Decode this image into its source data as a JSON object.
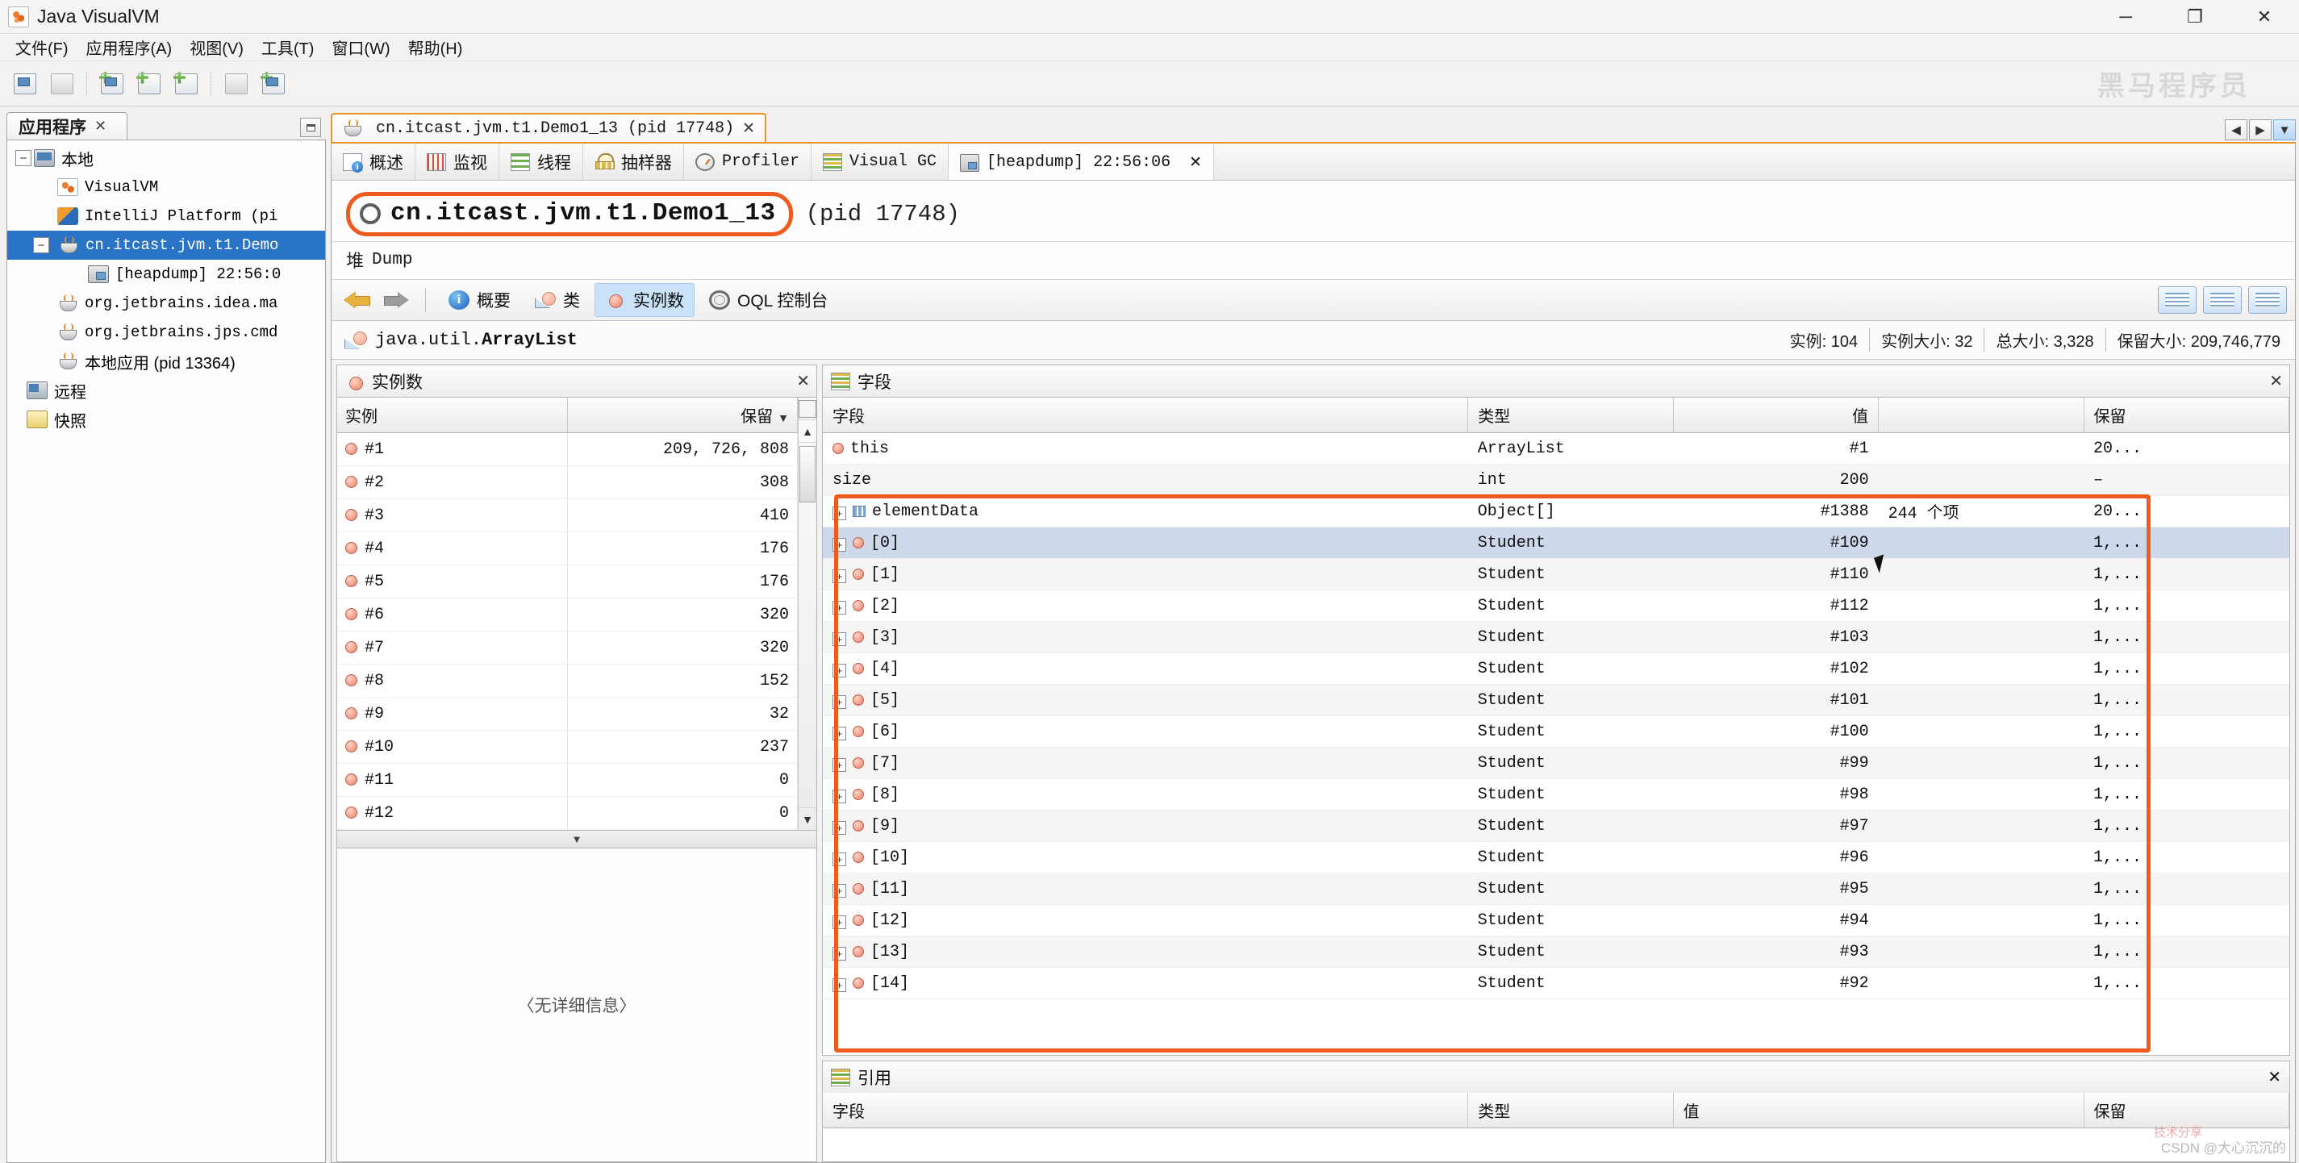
{
  "window": {
    "title": "Java VisualVM",
    "app_icon": "visualvm-icon",
    "controls": {
      "minimize": "─",
      "maximize": "❐",
      "close": "✕"
    }
  },
  "menubar": {
    "items": [
      {
        "label": "文件(F)",
        "name": "menu-file"
      },
      {
        "label": "应用程序(A)",
        "name": "menu-applications"
      },
      {
        "label": "视图(V)",
        "name": "menu-view"
      },
      {
        "label": "工具(T)",
        "name": "menu-tools"
      },
      {
        "label": "窗口(W)",
        "name": "menu-window"
      },
      {
        "label": "帮助(H)",
        "name": "menu-help"
      }
    ]
  },
  "toolbar": {
    "watermark": "黑马程序员",
    "buttons": [
      "load-snapshot-icon",
      "save-snapshot-icon",
      "add-remote-host-icon",
      "add-jmx-connection-icon",
      "add-application-icon",
      "profiler-snapshot-icon",
      "new-window-icon"
    ]
  },
  "sidebar": {
    "tab_label": "应用程序",
    "tab_close": "✕",
    "items": [
      {
        "label": "本地",
        "icon": "monitor-icon",
        "depth": 0,
        "expander": "−",
        "selected": false
      },
      {
        "label": "VisualVM",
        "icon": "visualvm-icon",
        "depth": 1,
        "expander": "",
        "selected": false
      },
      {
        "label": "IntelliJ Platform (pi",
        "icon": "intellij-icon",
        "depth": 1,
        "expander": "",
        "selected": false
      },
      {
        "label": "cn.itcast.jvm.t1.Demo",
        "icon": "java-coffee-icon",
        "depth": 1,
        "expander": "−",
        "selected": true
      },
      {
        "label": "[heapdump] 22:56:0",
        "icon": "heapdump-icon",
        "depth": 2,
        "expander": "",
        "selected": false
      },
      {
        "label": "org.jetbrains.idea.ma",
        "icon": "java-coffee-icon",
        "depth": 1,
        "expander": "",
        "selected": false
      },
      {
        "label": "org.jetbrains.jps.cmd",
        "icon": "java-coffee-icon",
        "depth": 1,
        "expander": "",
        "selected": false
      },
      {
        "label": "本地应用 (pid 13364)",
        "icon": "java-coffee-icon",
        "depth": 1,
        "expander": "",
        "selected": false
      },
      {
        "label": "远程",
        "icon": "remote-icon",
        "depth": 0,
        "expander": "",
        "selected": false
      },
      {
        "label": "快照",
        "icon": "snapshot-icon",
        "depth": 0,
        "expander": "",
        "selected": false
      }
    ]
  },
  "document_tab": {
    "label": "cn.itcast.jvm.t1.Demo1_13 (pid 17748)",
    "icon": "java-coffee-icon",
    "close": "✕",
    "nav_prev": "◀",
    "nav_next": "▶",
    "nav_list": "▼"
  },
  "subtabs": [
    {
      "label": "概述",
      "icon": "overview-icon",
      "active": false
    },
    {
      "label": "监视",
      "icon": "monitor-chart-icon",
      "active": false
    },
    {
      "label": "线程",
      "icon": "threads-icon",
      "active": false
    },
    {
      "label": "抽样器",
      "icon": "sampler-icon",
      "active": false
    },
    {
      "label": "Profiler",
      "icon": "profiler-icon",
      "active": false
    },
    {
      "label": "Visual GC",
      "icon": "visual-gc-icon",
      "active": false
    },
    {
      "label": "[heapdump] 22:56:06",
      "icon": "heapdump-icon",
      "active": true,
      "close": "✕"
    }
  ],
  "heap": {
    "title": "cn.itcast.jvm.t1.Demo1_13",
    "pid": "(pid 17748)",
    "section_glyph": "堆",
    "section_label": "Dump"
  },
  "navbar": {
    "back": "back-arrow-icon",
    "forward": "forward-arrow-icon",
    "items": [
      {
        "label": "概要",
        "icon": "info-icon",
        "active": false
      },
      {
        "label": "类",
        "icon": "classes-icon",
        "active": false
      },
      {
        "label": "实例数",
        "icon": "instances-icon",
        "active": true
      },
      {
        "label": "OQL 控制台",
        "icon": "oql-icon",
        "active": false
      }
    ],
    "right_buttons": [
      "view-mode-1-icon",
      "view-mode-2-icon",
      "view-mode-3-icon"
    ]
  },
  "classbar": {
    "icon": "classes-icon",
    "class_name_prefix": "java.util.",
    "class_name": "ArrayList",
    "stats": [
      "实例: 104",
      "实例大小: 32",
      "总大小: 3,328",
      "保留大小: 209,746,779"
    ]
  },
  "instances_panel": {
    "title": "实例数",
    "icon": "instances-icon",
    "close": "✕",
    "columns": [
      "实例",
      "保留"
    ],
    "sort_column": "保留",
    "sort_arrow": "▼",
    "rows": [
      {
        "instance": "#1",
        "retained": "209, 726, 808"
      },
      {
        "instance": "#2",
        "retained": "308"
      },
      {
        "instance": "#3",
        "retained": "410"
      },
      {
        "instance": "#4",
        "retained": "176"
      },
      {
        "instance": "#5",
        "retained": "176"
      },
      {
        "instance": "#6",
        "retained": "320"
      },
      {
        "instance": "#7",
        "retained": "320"
      },
      {
        "instance": "#8",
        "retained": "152"
      },
      {
        "instance": "#9",
        "retained": "32"
      },
      {
        "instance": "#10",
        "retained": "237"
      },
      {
        "instance": "#11",
        "retained": "0"
      },
      {
        "instance": "#12",
        "retained": "0"
      }
    ],
    "empty_detail": "〈无详细信息〉",
    "scroll_up": "▲",
    "scroll_down": "▼",
    "collapse": "▼"
  },
  "fields_panel": {
    "title": "字段",
    "icon": "fields-icon",
    "close": "✕",
    "columns": [
      "字段",
      "类型",
      "值",
      "保留"
    ],
    "rows": [
      {
        "field": "this",
        "kind": "root",
        "type": "ArrayList",
        "value": "#1",
        "value2": "",
        "retained": "20...",
        "selected": false
      },
      {
        "field": "size",
        "kind": "leaf",
        "type": "int",
        "value": "200",
        "value2": "",
        "retained": "–",
        "selected": false
      },
      {
        "field": "elementData",
        "kind": "array",
        "type": "Object[]",
        "value": "#1388",
        "value2": "244 个项",
        "retained": "20...",
        "selected": false
      },
      {
        "field": "[0]",
        "kind": "child",
        "type": "Student",
        "value": "#109",
        "value2": "",
        "retained": "1,...",
        "selected": true
      },
      {
        "field": "[1]",
        "kind": "child",
        "type": "Student",
        "value": "#110",
        "value2": "",
        "retained": "1,...",
        "selected": false
      },
      {
        "field": "[2]",
        "kind": "child",
        "type": "Student",
        "value": "#112",
        "value2": "",
        "retained": "1,...",
        "selected": false
      },
      {
        "field": "[3]",
        "kind": "child",
        "type": "Student",
        "value": "#103",
        "value2": "",
        "retained": "1,...",
        "selected": false
      },
      {
        "field": "[4]",
        "kind": "child",
        "type": "Student",
        "value": "#102",
        "value2": "",
        "retained": "1,...",
        "selected": false
      },
      {
        "field": "[5]",
        "kind": "child",
        "type": "Student",
        "value": "#101",
        "value2": "",
        "retained": "1,...",
        "selected": false
      },
      {
        "field": "[6]",
        "kind": "child",
        "type": "Student",
        "value": "#100",
        "value2": "",
        "retained": "1,...",
        "selected": false
      },
      {
        "field": "[7]",
        "kind": "child",
        "type": "Student",
        "value": "#99",
        "value2": "",
        "retained": "1,...",
        "selected": false
      },
      {
        "field": "[8]",
        "kind": "child",
        "type": "Student",
        "value": "#98",
        "value2": "",
        "retained": "1,...",
        "selected": false
      },
      {
        "field": "[9]",
        "kind": "child",
        "type": "Student",
        "value": "#97",
        "value2": "",
        "retained": "1,...",
        "selected": false
      },
      {
        "field": "[10]",
        "kind": "child",
        "type": "Student",
        "value": "#96",
        "value2": "",
        "retained": "1,...",
        "selected": false
      },
      {
        "field": "[11]",
        "kind": "child",
        "type": "Student",
        "value": "#95",
        "value2": "",
        "retained": "1,...",
        "selected": false
      },
      {
        "field": "[12]",
        "kind": "child",
        "type": "Student",
        "value": "#94",
        "value2": "",
        "retained": "1,...",
        "selected": false
      },
      {
        "field": "[13]",
        "kind": "child",
        "type": "Student",
        "value": "#93",
        "value2": "",
        "retained": "1,...",
        "selected": false
      },
      {
        "field": "[14]",
        "kind": "child",
        "type": "Student",
        "value": "#92",
        "value2": "",
        "retained": "1,...",
        "selected": false
      }
    ],
    "expander": "+"
  },
  "references_panel": {
    "title": "引用",
    "icon": "references-icon",
    "close": "✕",
    "columns": [
      "字段",
      "类型",
      "值",
      "保留"
    ]
  },
  "watermarks": {
    "bottom_right": "CSDN @大心沉沉的",
    "red_note": "技术分享"
  },
  "colors": {
    "accent_orange": "#ef5a1e",
    "selection_blue": "#2a74c8",
    "row_selected": "#cdd8ea",
    "tab_active": "#c9e2f8"
  }
}
